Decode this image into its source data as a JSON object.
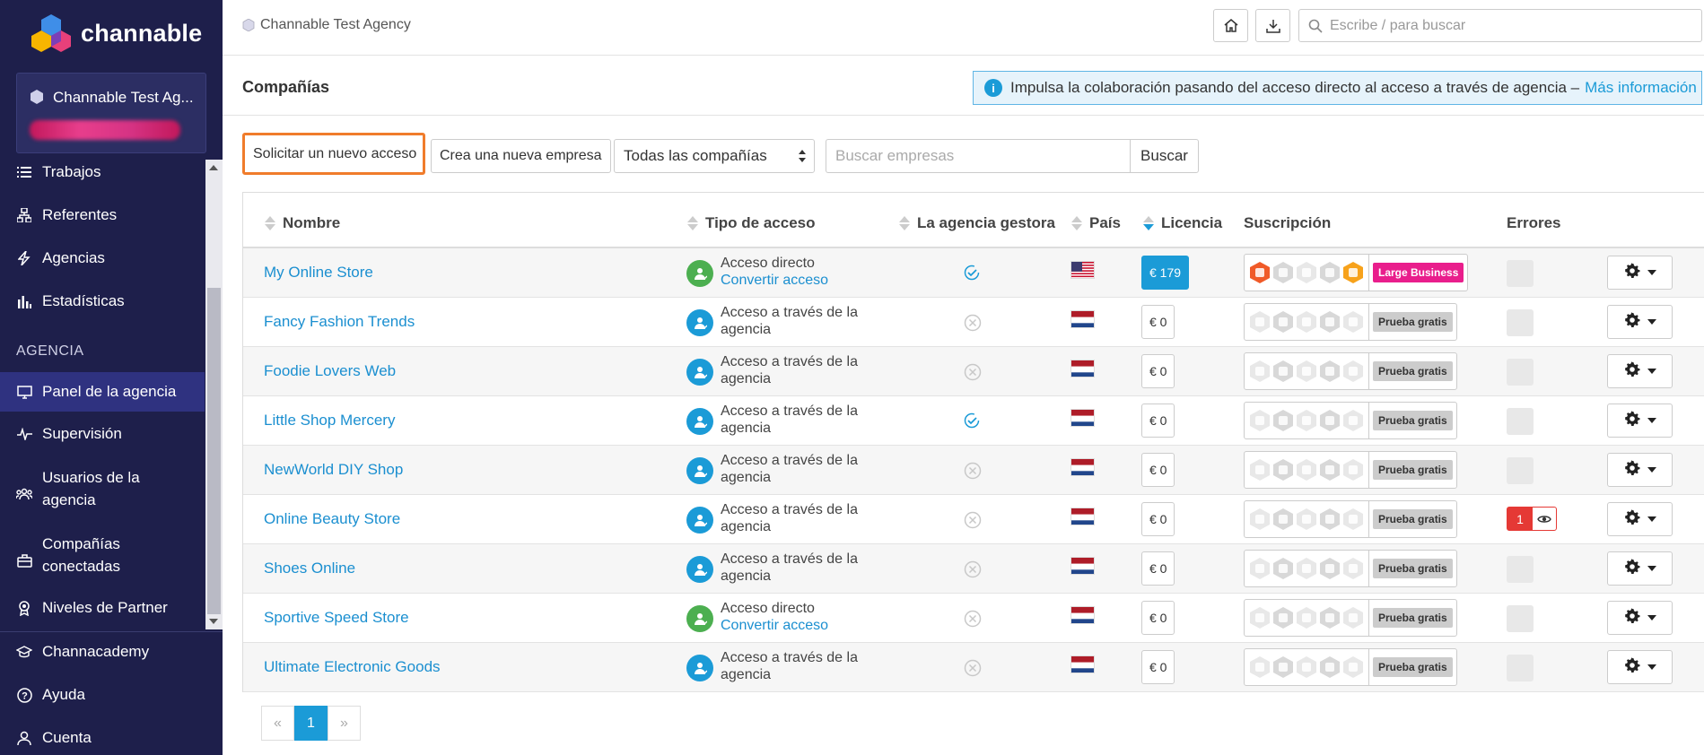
{
  "app": {
    "brand": "channable"
  },
  "sidebar": {
    "account_name": "Channable Test Ag...",
    "items_top": [
      {
        "label": "Trabajos",
        "icon": "list-icon"
      },
      {
        "label": "Referentes",
        "icon": "sitemap-icon"
      },
      {
        "label": "Agencias",
        "icon": "bolt-icon"
      },
      {
        "label": "Estadísticas",
        "icon": "bar-chart-icon"
      }
    ],
    "section_label": "AGENCIA",
    "items_agency": [
      {
        "label": "Panel de la agencia",
        "icon": "monitor-icon",
        "active": true
      },
      {
        "label": "Supervisión",
        "icon": "pulse-icon"
      },
      {
        "label": "Usuarios de la agencia",
        "icon": "users-icon"
      },
      {
        "label": "Compañías conectadas",
        "icon": "briefcase-icon"
      },
      {
        "label": "Niveles de Partner",
        "icon": "award-icon"
      }
    ],
    "items_bottom": [
      {
        "label": "Channacademy",
        "icon": "graduation-cap-icon"
      },
      {
        "label": "Ayuda",
        "icon": "help-circle-icon"
      },
      {
        "label": "Cuenta",
        "icon": "user-icon"
      }
    ]
  },
  "topbar": {
    "breadcrumb": "Channable Test Agency",
    "search_placeholder": "Escribe / para buscar"
  },
  "page": {
    "title": "Compañías",
    "banner_text": "Impulsa la colaboración pasando del acceso directo al acceso a través de agencia –",
    "banner_link": "Más información"
  },
  "toolbar": {
    "request_access": "Solicitar un nuevo acceso",
    "new_company": "Crea una nueva empresa",
    "filter_selected": "Todas las compañías",
    "search_placeholder": "Buscar empresas",
    "search_button": "Buscar"
  },
  "table": {
    "columns": [
      "Nombre",
      "Tipo de acceso",
      "La agencia gestora",
      "País",
      "Licencia",
      "Suscripción",
      "Errores"
    ],
    "rows": [
      {
        "name": "My Online Store",
        "access": "Acceso directo",
        "access_link": "Convertir acceso",
        "access_type": "direct",
        "managing": true,
        "country": "US",
        "license": "€ 179",
        "plan": "Large Business",
        "errors": "0",
        "has_errors": false
      },
      {
        "name": "Fancy Fashion Trends",
        "access": "Acceso a través de la agencia",
        "access_link": "",
        "access_type": "agency",
        "managing": false,
        "country": "NL",
        "license": "€ 0",
        "plan": "Prueba gratis",
        "errors": "0",
        "has_errors": false
      },
      {
        "name": "Foodie Lovers Web",
        "access": "Acceso a través de la agencia",
        "access_link": "",
        "access_type": "agency",
        "managing": false,
        "country": "NL",
        "license": "€ 0",
        "plan": "Prueba gratis",
        "errors": "0",
        "has_errors": false
      },
      {
        "name": "Little Shop Mercery",
        "access": "Acceso a través de la agencia",
        "access_link": "",
        "access_type": "agency",
        "managing": true,
        "country": "NL",
        "license": "€ 0",
        "plan": "Prueba gratis",
        "errors": "0",
        "has_errors": false
      },
      {
        "name": "NewWorld DIY Shop",
        "access": "Acceso a través de la agencia",
        "access_link": "",
        "access_type": "agency",
        "managing": false,
        "country": "NL",
        "license": "€ 0",
        "plan": "Prueba gratis",
        "errors": "0",
        "has_errors": false
      },
      {
        "name": "Online Beauty Store",
        "access": "Acceso a través de la agencia",
        "access_link": "",
        "access_type": "agency",
        "managing": false,
        "country": "NL",
        "license": "€ 0",
        "plan": "Prueba gratis",
        "errors": "1",
        "has_errors": true
      },
      {
        "name": "Shoes Online",
        "access": "Acceso a través de la agencia",
        "access_link": "",
        "access_type": "agency",
        "managing": false,
        "country": "NL",
        "license": "€ 0",
        "plan": "Prueba gratis",
        "errors": "0",
        "has_errors": false
      },
      {
        "name": "Sportive Speed Store",
        "access": "Acceso directo",
        "access_link": "Convertir acceso",
        "access_type": "direct",
        "managing": false,
        "country": "NL",
        "license": "€ 0",
        "plan": "Prueba gratis",
        "errors": "0",
        "has_errors": false
      },
      {
        "name": "Ultimate Electronic Goods",
        "access": "Acceso a través de la agencia",
        "access_link": "",
        "access_type": "agency",
        "managing": false,
        "country": "NL",
        "license": "€ 0",
        "plan": "Prueba gratis",
        "errors": "0",
        "has_errors": false
      }
    ]
  },
  "pagination": {
    "prev": "«",
    "current": "1",
    "next": "»"
  },
  "colors": {
    "sidebar": "#1e1f4b",
    "accent": "#1b9bd7",
    "highlight": "#f07c2b",
    "plan_business": "#e91e8c",
    "error": "#e53935"
  }
}
